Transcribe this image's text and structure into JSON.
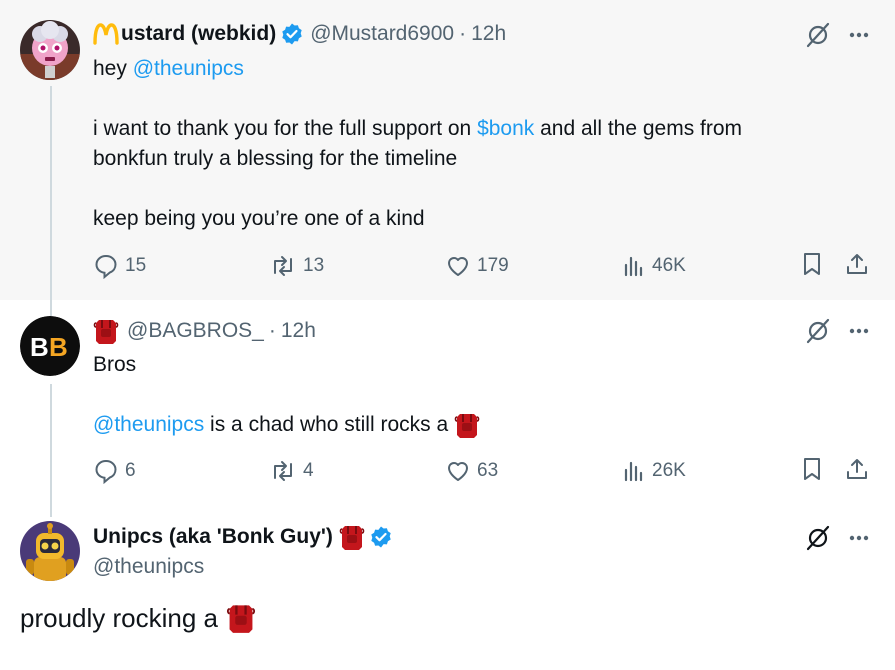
{
  "tweets": [
    {
      "author_name": "ustard (webkid)",
      "author_prefix": "M",
      "handle": "@Mustard6900",
      "time": "12h",
      "lines": [
        [
          "hey ",
          "@theunipcs"
        ],
        [
          "i want to thank you for the full support on ",
          "$bonk",
          " and all the gems from"
        ],
        [
          "bonkfun truly a blessing for the timeline"
        ],
        [
          "keep being you you’re one of a kind"
        ]
      ],
      "replies": "15",
      "reposts": "13",
      "likes": "179",
      "views": "46K"
    },
    {
      "handle": "@BAGBROS_",
      "time": "12h",
      "avatar_text": "BB",
      "line1": "Bros",
      "line2_mention": "@theunipcs",
      "line2_rest": " is a chad who still rocks a",
      "replies": "6",
      "reposts": "4",
      "likes": "63",
      "views": "26K"
    },
    {
      "author_name": "Unipcs (aka 'Bonk Guy')",
      "handle": "@theunipcs",
      "body": "proudly rocking a"
    }
  ],
  "colors": {
    "link": "#1d9bf0",
    "verified": "#1d9bf0",
    "muted": "#536471",
    "highlight_bg": "#f7f7f7",
    "bag_red": "#c4161c"
  },
  "icons": [
    "grok-icon",
    "more-icon",
    "reply-icon",
    "repost-icon",
    "like-icon",
    "views-icon",
    "bookmark-icon",
    "share-icon",
    "verified-icon",
    "bag-emoji"
  ]
}
